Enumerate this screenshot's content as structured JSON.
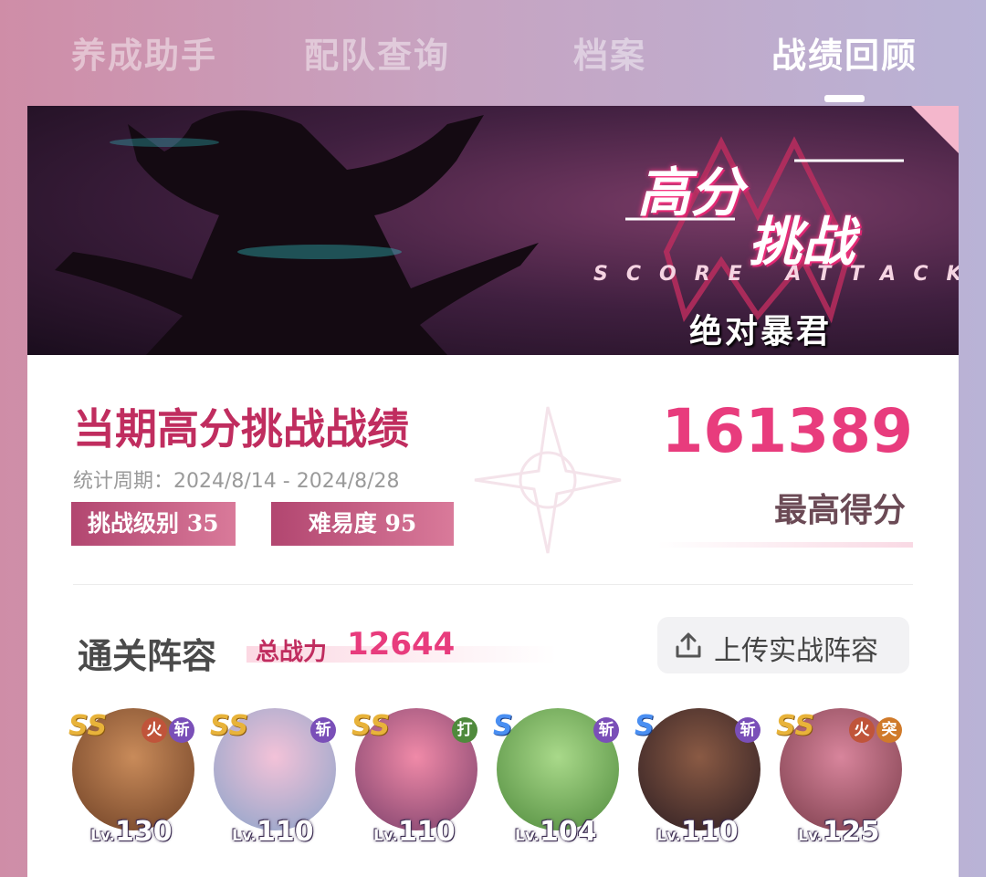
{
  "tabs": [
    {
      "label": "养成助手",
      "active": false
    },
    {
      "label": "配队查询",
      "active": false
    },
    {
      "label": "档案",
      "active": false
    },
    {
      "label": "战绩回顾",
      "active": true
    }
  ],
  "banner": {
    "title_line1": "高分",
    "title_line2": "挑战",
    "subtitle": "SCORE ATTACK",
    "boss": "绝对暴君"
  },
  "summary": {
    "title": "当期高分挑战战绩",
    "period": "统计周期：2024/8/14 - 2024/8/28",
    "badges": [
      "挑战级别 35",
      "难易度 95"
    ],
    "score": "161389",
    "score_label": "最高得分"
  },
  "lineup": {
    "title": "通关阵容",
    "power_label": "总战力",
    "power_value": "12644",
    "upload_label": "上传实战阵容"
  },
  "characters": [
    {
      "rank": "SS",
      "tags": [
        "火",
        "斩"
      ],
      "lv_prefix": "Lv.",
      "level": "130",
      "colors": [
        "#c98b5a",
        "#6e4025"
      ]
    },
    {
      "rank": "SS",
      "tags": [
        "斩"
      ],
      "lv_prefix": "Lv.",
      "level": "110",
      "colors": [
        "#f3c2d8",
        "#8aa3c9"
      ]
    },
    {
      "rank": "SS",
      "tags": [
        "打"
      ],
      "lv_prefix": "Lv.",
      "level": "110",
      "colors": [
        "#f08aa8",
        "#7a3f6a"
      ]
    },
    {
      "rank": "S",
      "tags": [
        "斩"
      ],
      "lv_prefix": "Lv.",
      "level": "104",
      "colors": [
        "#a9d98a",
        "#4f8a3c"
      ]
    },
    {
      "rank": "S",
      "tags": [
        "斩"
      ],
      "lv_prefix": "Lv.",
      "level": "110",
      "colors": [
        "#8a5a44",
        "#2c1d22"
      ]
    },
    {
      "rank": "SS",
      "tags": [
        "火",
        "突"
      ],
      "lv_prefix": "Lv.",
      "level": "125",
      "colors": [
        "#d8859c",
        "#7a3c4a"
      ]
    }
  ]
}
